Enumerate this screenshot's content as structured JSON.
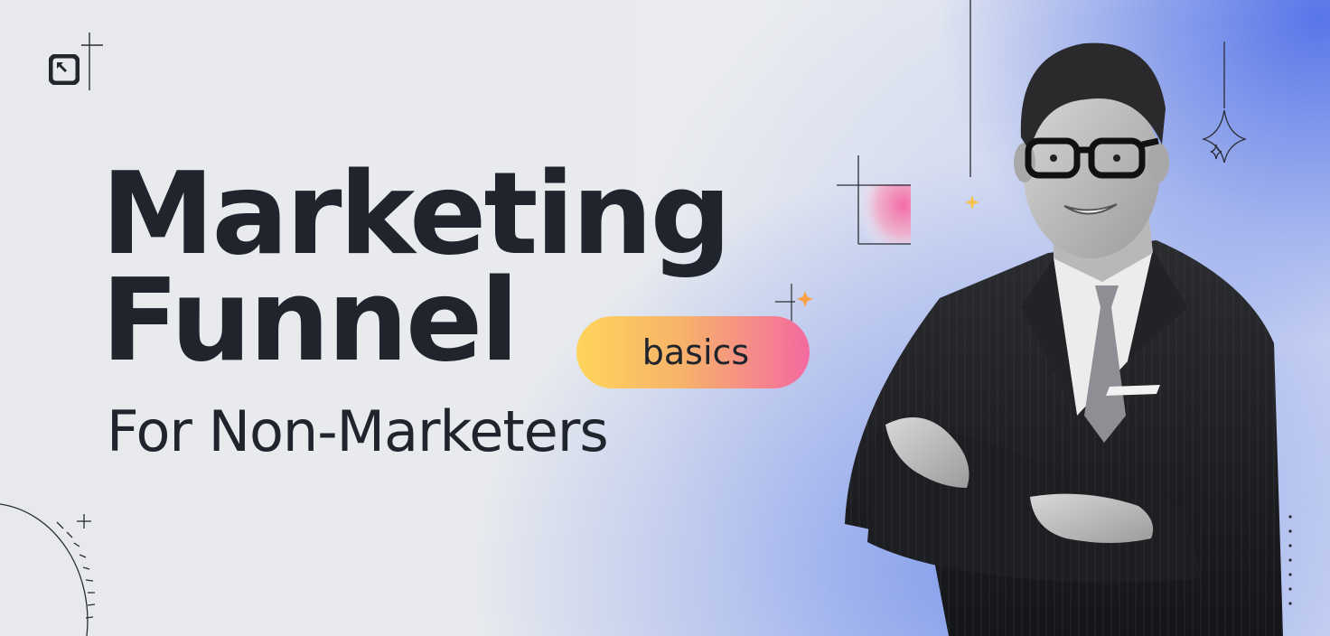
{
  "headline": {
    "line1": "Marketing",
    "line2": "Funnel",
    "subline": "For Non-Marketers"
  },
  "badge": {
    "label": "basics"
  },
  "colors": {
    "text": "#20242c",
    "blue_glow": "#5070e8",
    "pill_start": "#ffd45c",
    "pill_end": "#f46aa0",
    "accent_pink": "#f46aa0",
    "accent_orange": "#f7a24a"
  },
  "icons": {
    "logo": "square-logo-icon",
    "sparkles": [
      "sparkle-icon",
      "four-point-star-icon"
    ]
  }
}
